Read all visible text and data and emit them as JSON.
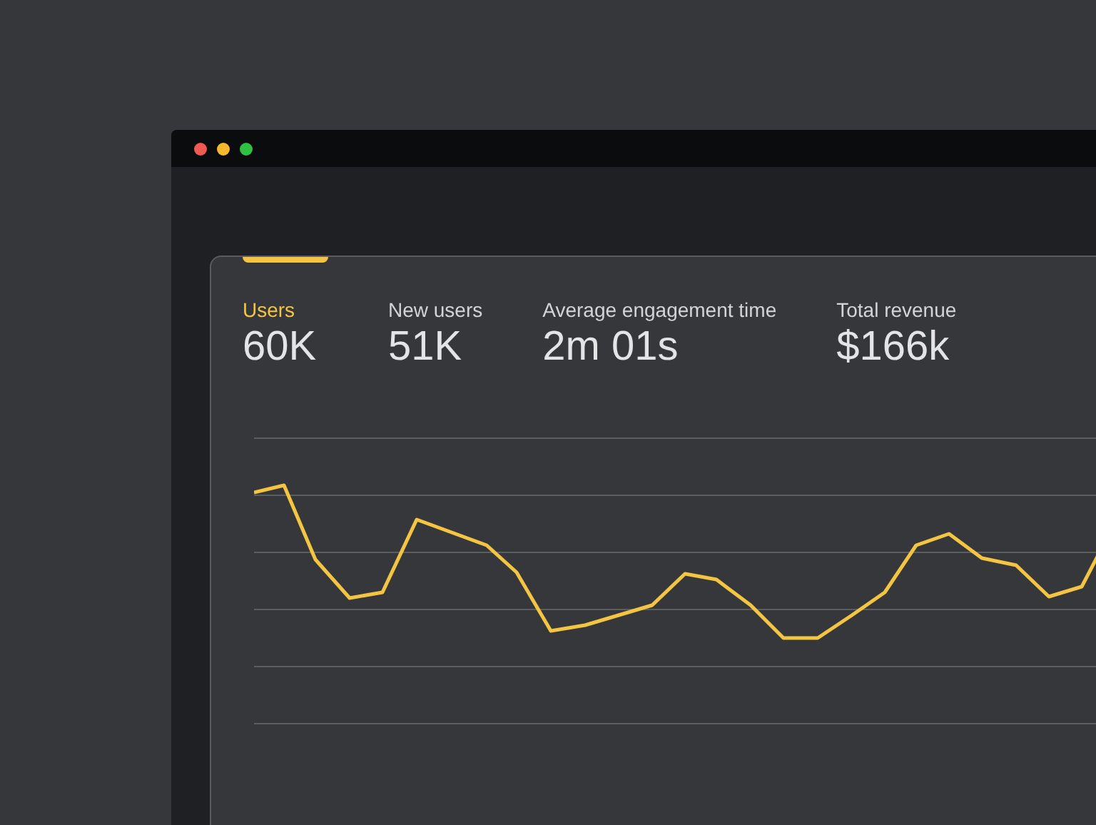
{
  "window": {
    "controls": [
      {
        "color": "#ee5a52"
      },
      {
        "color": "#f5b82e"
      },
      {
        "color": "#2fc142"
      }
    ]
  },
  "metrics": [
    {
      "label": "Users",
      "value": "60K",
      "selected": true
    },
    {
      "label": "New users",
      "value": "51K",
      "selected": false
    },
    {
      "label": "Average engagement time",
      "value": "2m 01s",
      "selected": false
    },
    {
      "label": "Total revenue",
      "value": "$166k",
      "selected": false
    }
  ]
}
